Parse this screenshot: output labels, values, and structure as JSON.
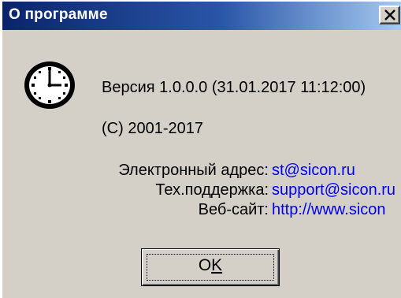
{
  "window": {
    "title": "О программе",
    "close_icon": "close-x-icon"
  },
  "about": {
    "version": "Версия 1.0.0.0 (31.01.2017 11:12:00)",
    "copyright": "(C) 2001-2017",
    "email_label": "Электронный адрес:",
    "email_value": "st@sicon.ru",
    "support_label": "Тех.поддержка:",
    "support_value": "support@sicon.ru",
    "website_label": "Веб-сайт:",
    "website_value": "http://www.sicon"
  },
  "buttons": {
    "ok_main": "O",
    "ok_underlined": "K"
  },
  "colors": {
    "title_bar_start": "#0a246a",
    "title_bar_end": "#a6caf0",
    "link": "#0000ee",
    "face": "#d4d0c8"
  }
}
